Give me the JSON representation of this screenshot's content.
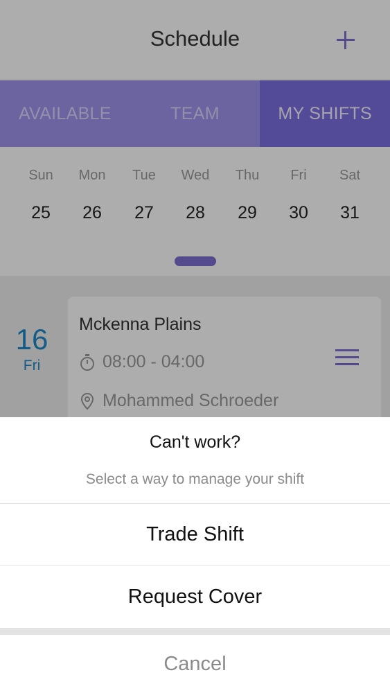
{
  "header": {
    "title": "Schedule",
    "add_icon": "plus-icon"
  },
  "tabs": [
    {
      "label": "AVAILABLE",
      "active": false
    },
    {
      "label": "TEAM",
      "active": false
    },
    {
      "label": "MY SHIFTS",
      "active": true
    }
  ],
  "week": {
    "days": [
      {
        "name": "Sun",
        "date": "25"
      },
      {
        "name": "Mon",
        "date": "26"
      },
      {
        "name": "Tue",
        "date": "27"
      },
      {
        "name": "Wed",
        "date": "28"
      },
      {
        "name": "Thu",
        "date": "29"
      },
      {
        "name": "Fri",
        "date": "30"
      },
      {
        "name": "Sat",
        "date": "31"
      }
    ]
  },
  "shift": {
    "day_number": "16",
    "day_name": "Fri",
    "location": "Mckenna Plains",
    "time": "08:00 - 04:00",
    "person": "Mohammed Schroeder",
    "time_icon": "stopwatch-icon",
    "person_icon": "location-pin-icon",
    "menu_icon": "hamburger-menu-icon"
  },
  "action_sheet": {
    "title": "Can't work?",
    "subtitle": "Select a way to manage your shift",
    "options": [
      {
        "label": "Trade Shift"
      },
      {
        "label": "Request Cover"
      }
    ],
    "cancel_label": "Cancel"
  },
  "colors": {
    "accent": "#7b6fd0",
    "tab_bar": "#9f93ee",
    "tab_active": "#7b6ee0",
    "date_blue": "#1e88c8"
  }
}
